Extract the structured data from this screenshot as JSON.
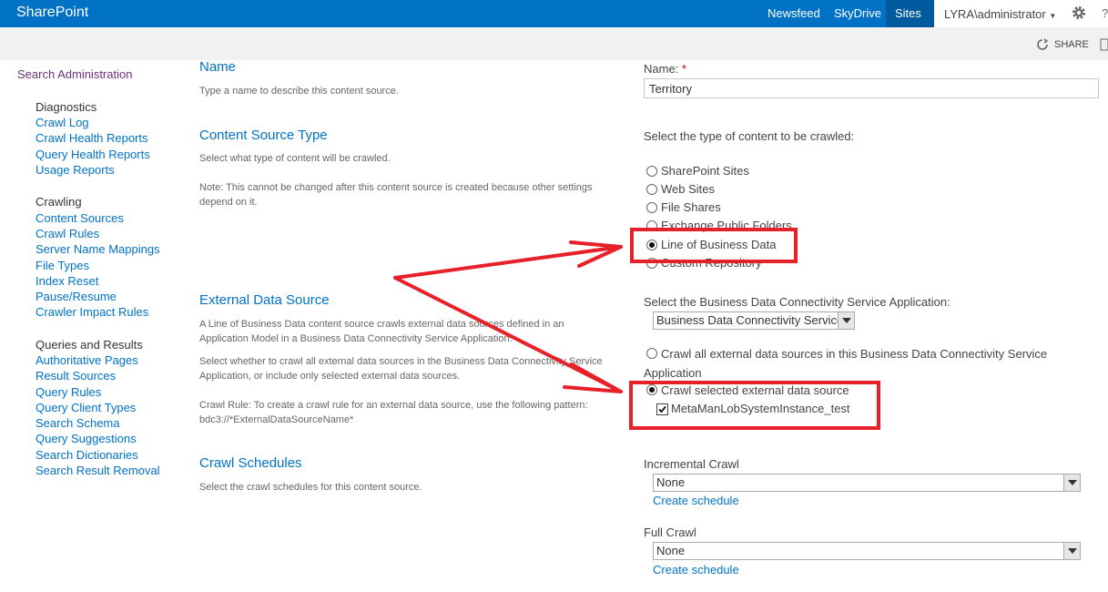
{
  "suitebar": {
    "brand": "SharePoint",
    "links": [
      "Newsfeed",
      "SkyDrive",
      "Sites"
    ],
    "user": "LYRA\\administrator",
    "help": "?"
  },
  "ribbon": {
    "share": "SHARE"
  },
  "nav": {
    "top": "Search Administration",
    "groups": [
      {
        "heading": "Diagnostics",
        "items": [
          "Crawl Log",
          "Crawl Health Reports",
          "Query Health Reports",
          "Usage Reports"
        ]
      },
      {
        "heading": "Crawling",
        "items": [
          "Content Sources",
          "Crawl Rules",
          "Server Name Mappings",
          "File Types",
          "Index Reset",
          "Pause/Resume",
          "Crawler Impact Rules"
        ]
      },
      {
        "heading": "Queries and Results",
        "items": [
          "Authoritative Pages",
          "Result Sources",
          "Query Rules",
          "Query Client Types",
          "Search Schema",
          "Query Suggestions",
          "Search Dictionaries",
          "Search Result Removal"
        ]
      }
    ]
  },
  "name_section": {
    "title": "Name",
    "desc": "Type a name to describe this content source.",
    "label": "Name:",
    "required": "*",
    "value": "Territory"
  },
  "type_section": {
    "title": "Content Source Type",
    "desc": "Select what type of content will be crawled.",
    "note": "Note: This cannot be changed after this content source is created because other settings depend on it.",
    "prompt": "Select the type of content to be crawled:",
    "options": [
      "SharePoint Sites",
      "Web Sites",
      "File Shares",
      "Exchange Public Folders",
      "Line of Business Data",
      "Custom Repository"
    ],
    "selected": "Line of Business Data"
  },
  "eds_section": {
    "title": "External Data Source",
    "desc1": "A Line of Business Data content source crawls external data sources defined in an Application Model in a Business Data Connectivity Service Application.",
    "desc2": "Select whether to crawl all external data sources in the Business Data Connectivity Service Application, or include only selected external data sources.",
    "desc3": "Crawl Rule: To create a crawl rule for an external data source, use the following pattern: bdc3://*ExternalDataSourceName*",
    "prompt": "Select the Business Data Connectivity Service Application:",
    "service_value": "Business Data Connectivity Service",
    "opt_all_line1": "Crawl all external data sources in this Business Data Connectivity Service",
    "opt_all_line2": "Application",
    "opt_selected": "Crawl selected external data source",
    "checkbox_label": "MetaManLobSystemInstance_test"
  },
  "schedule_section": {
    "title": "Crawl Schedules",
    "desc": "Select the crawl schedules for this content source.",
    "incremental_label": "Incremental Crawl",
    "incremental_value": "None",
    "full_label": "Full Crawl",
    "full_value": "None",
    "create_link": "Create schedule"
  },
  "colors": {
    "suitebar": "#0072c6",
    "link": "#0072c6",
    "annotation": "#e8202a"
  }
}
